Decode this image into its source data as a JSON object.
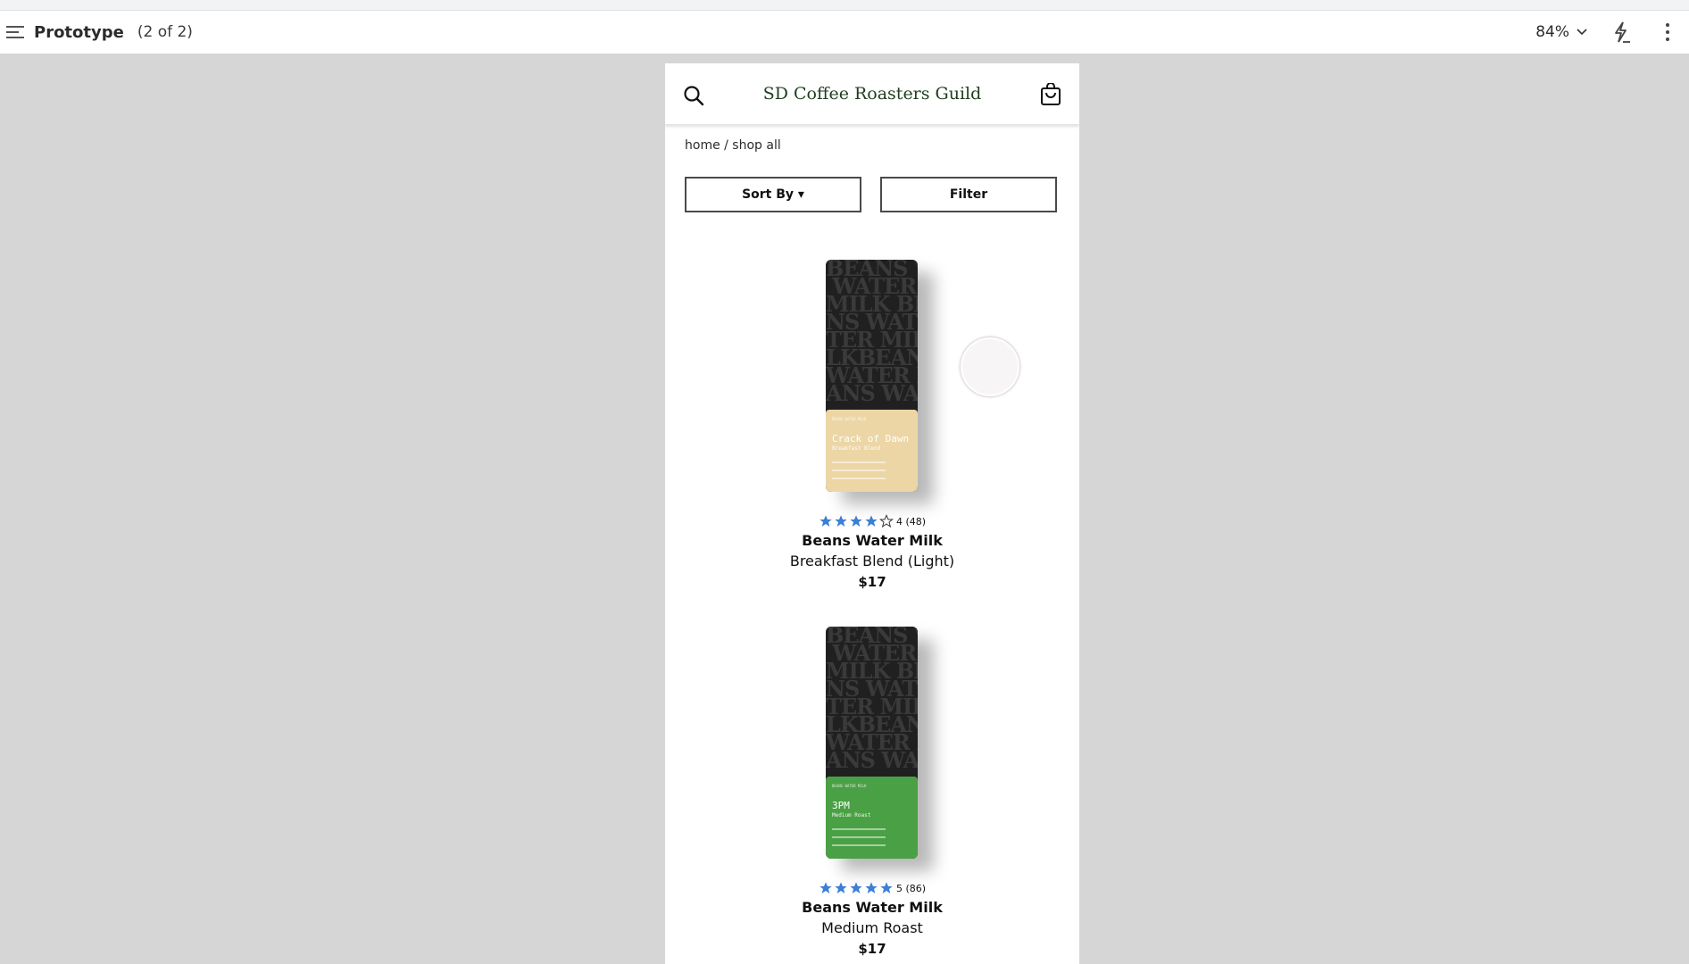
{
  "toolbar": {
    "title": "Prototype",
    "page_count": "(2 of 2)",
    "zoom": "84%",
    "icons": [
      "hamburger-icon",
      "chevron-down-icon",
      "lightning-icon",
      "kebab-icon"
    ]
  },
  "site": {
    "title": "SD Coffee Roasters Guild",
    "breadcrumb": "home / shop all",
    "sort_label": "Sort By ▾",
    "filter_label": "Filter"
  },
  "products": [
    {
      "rating_text": "4 (48)",
      "rating": 4,
      "brand": "Beans Water Milk",
      "name": "Breakfast Blend (Light)",
      "price": "$17",
      "bag_label_color": "#ecd6a6",
      "bag_label_name": "Crack of Dawn",
      "bag_label_sub": "Breakfast Blend"
    },
    {
      "rating_text": "5 (86)",
      "rating": 5,
      "brand": "Beans Water Milk",
      "name": "Medium Roast",
      "price": "$17",
      "bag_label_color": "#4aa044",
      "bag_label_name": "3PM",
      "bag_label_sub": "Medium Roast"
    }
  ],
  "colors": {
    "star": "#3b7fd6",
    "canvas": "#d6d6d6"
  }
}
